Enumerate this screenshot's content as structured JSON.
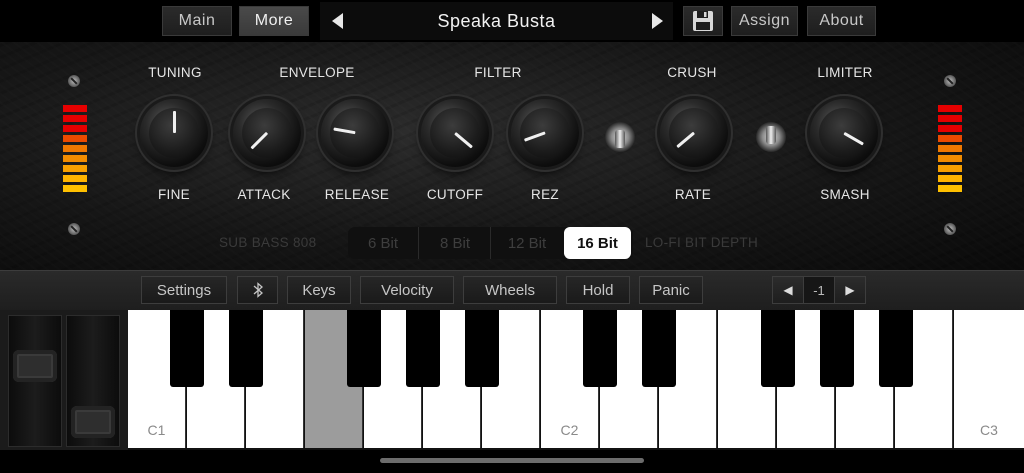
{
  "topbar": {
    "main_label": "Main",
    "more_label": "More",
    "preset_name": "Speaka Busta",
    "assign_label": "Assign",
    "about_label": "About",
    "save_icon": "save-icon"
  },
  "sections": {
    "tuning": "TUNING",
    "envelope": "ENVELOPE",
    "filter": "FILTER",
    "crush": "CRUSH",
    "limiter": "LIMITER"
  },
  "knobs": {
    "fine": "FINE",
    "attack": "ATTACK",
    "release": "RELEASE",
    "cutoff": "CUTOFF",
    "rez": "REZ",
    "rate": "RATE",
    "smash": "SMASH"
  },
  "bitdepth": {
    "left_label": "SUB BASS 808",
    "options": [
      "6 Bit",
      "8 Bit",
      "12 Bit",
      "16 Bit"
    ],
    "selected": "16 Bit",
    "right_label": "LO-FI BIT DEPTH"
  },
  "controls": {
    "settings": "Settings",
    "bluetooth_icon": "bluetooth-icon",
    "keys": "Keys",
    "velocity": "Velocity",
    "wheels": "Wheels",
    "hold": "Hold",
    "panic": "Panic",
    "octave_value": "-1"
  },
  "keyboard": {
    "labels": {
      "c1": "C1",
      "c2": "C2",
      "c3": "C3"
    },
    "pressed_key": "E1"
  },
  "colors": {
    "meter_red": "#e60000",
    "meter_orange": "#f07800",
    "meter_yellow": "#ffb400",
    "selected_bit_bg": "#ffffff"
  }
}
